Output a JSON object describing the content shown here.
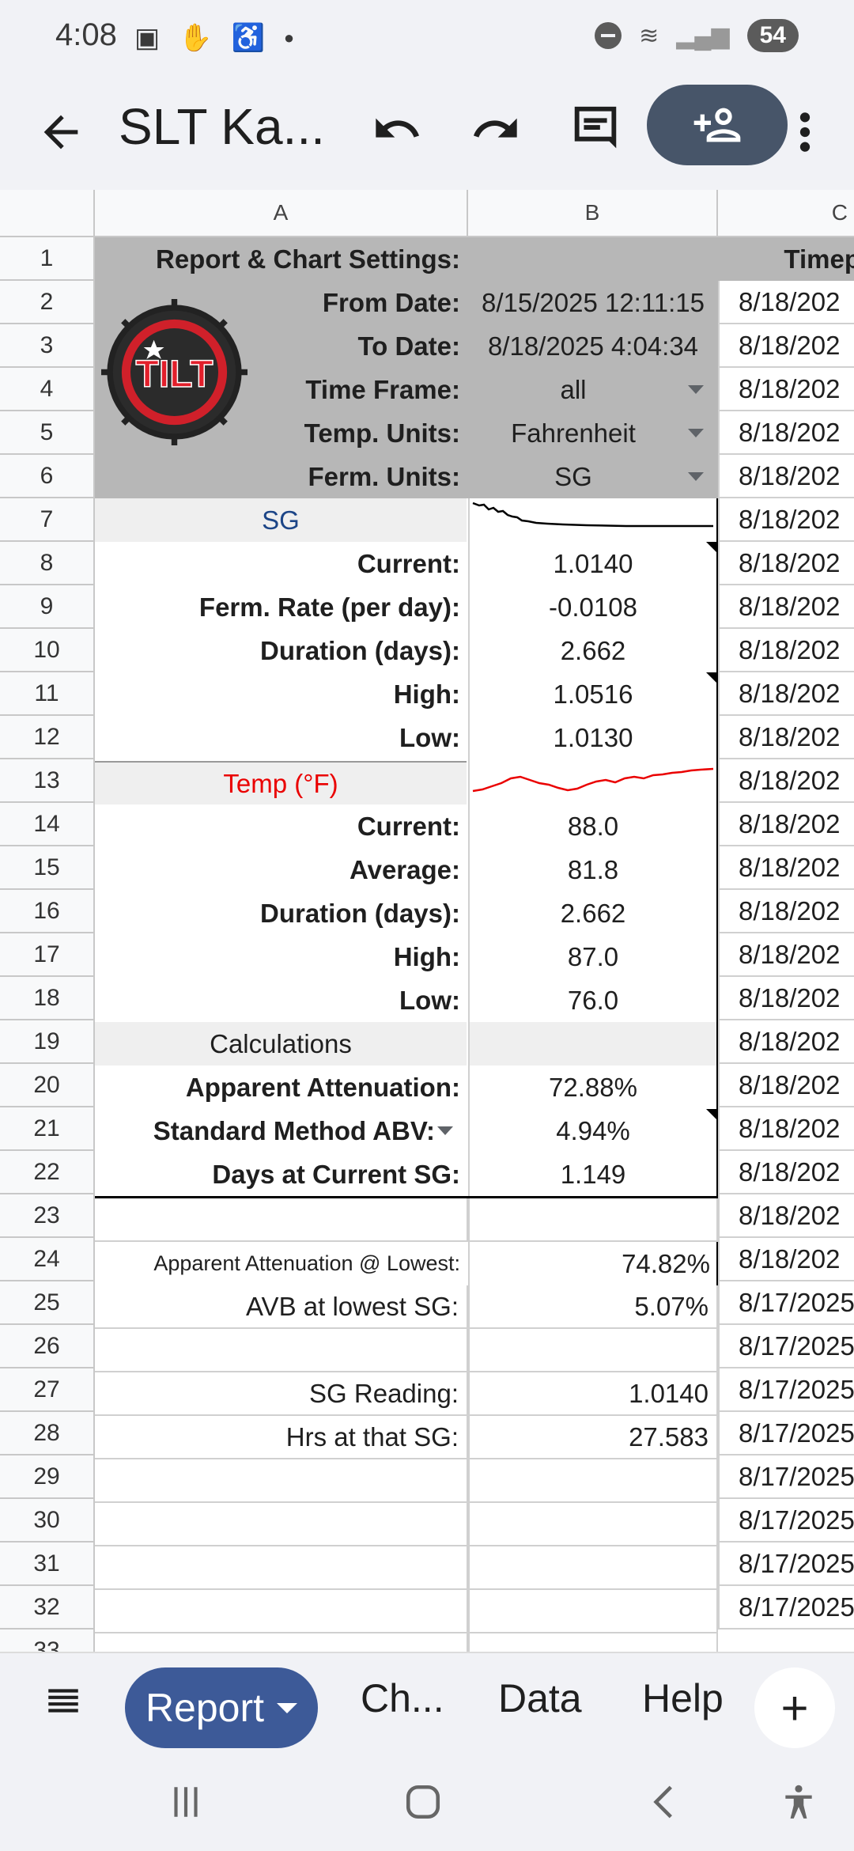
{
  "status": {
    "time": "4:08",
    "battery": "54"
  },
  "appbar": {
    "title": "SLT Ka..."
  },
  "columns": {
    "a": "A",
    "b": "B",
    "c": "C"
  },
  "rows": [
    "1",
    "2",
    "3",
    "4",
    "5",
    "6",
    "7",
    "8",
    "9",
    "10",
    "11",
    "12",
    "13",
    "14",
    "15",
    "16",
    "17",
    "18",
    "19",
    "20",
    "21",
    "22",
    "23",
    "24",
    "25",
    "26",
    "27",
    "28",
    "29",
    "30",
    "31",
    "32",
    "33"
  ],
  "report": {
    "settings_header": "Report & Chart Settings:",
    "time_header": "Timep",
    "from_date_label": "From Date:",
    "from_date_value": "8/15/2025 12:11:15",
    "to_date_label": "To Date:",
    "to_date_value": "8/18/2025 4:04:34",
    "time_frame_label": "Time Frame:",
    "time_frame_value": "all",
    "temp_units_label": "Temp. Units:",
    "temp_units_value": "Fahrenheit",
    "ferm_units_label": "Ferm. Units:",
    "ferm_units_value": "SG",
    "logo_text": "TILT",
    "sg_header": "SG",
    "sg_current_label": "Current:",
    "sg_current_value": "1.0140",
    "ferm_rate_label": "Ferm. Rate (per day):",
    "ferm_rate_value": "-0.0108",
    "sg_duration_label": "Duration (days):",
    "sg_duration_value": "2.662",
    "sg_high_label": "High:",
    "sg_high_value": "1.0516",
    "sg_low_label": "Low:",
    "sg_low_value": "1.0130",
    "temp_header": "Temp (°F)",
    "temp_current_label": "Current:",
    "temp_current_value": "88.0",
    "temp_avg_label": "Average:",
    "temp_avg_value": "81.8",
    "temp_duration_label": "Duration (days):",
    "temp_duration_value": "2.662",
    "temp_high_label": "High:",
    "temp_high_value": "87.0",
    "temp_low_label": "Low:",
    "temp_low_value": "76.0",
    "calc_header": "Calculations",
    "attenuation_label": "Apparent Attenuation:",
    "attenuation_value": "72.88%",
    "abv_label": "Standard Method ABV:",
    "abv_value": "4.94%",
    "days_sg_label": "Days at Current SG:",
    "days_sg_value": "1.149",
    "att_lowest_label": "Apparent Attenuation @ Lowest:",
    "att_lowest_value": "74.82%",
    "avb_lowest_label": "AVB at lowest SG:",
    "avb_lowest_value": "5.07%",
    "sg_reading_label": "SG Reading:",
    "sg_reading_value": "1.0140",
    "hrs_label": "Hrs at that SG:",
    "hrs_value": "27.583"
  },
  "col_c_values": [
    "8/18/202",
    "8/18/202",
    "8/18/202",
    "8/18/202",
    "8/18/202",
    "8/18/202",
    "8/18/202",
    "8/18/202",
    "8/18/202",
    "8/18/202",
    "8/18/202",
    "8/18/202",
    "8/18/202",
    "8/18/202",
    "8/18/202",
    "8/18/202",
    "8/18/202",
    "8/18/202",
    "8/18/202",
    "8/18/202",
    "8/18/202",
    "8/18/202",
    "8/18/202",
    "8/17/2025",
    "8/17/2025",
    "8/17/2025",
    "8/17/2025",
    "8/17/2025",
    "8/17/2025",
    "8/17/2025",
    "8/17/2025"
  ],
  "tabs": {
    "report": "Report",
    "charts": "Ch...",
    "data": "Data",
    "help": "Help"
  },
  "colors": {
    "sg_blue": "#1c4587",
    "temp_red": "#ea0000",
    "share_bg": "#475569",
    "tab_active": "#3d5a98"
  }
}
